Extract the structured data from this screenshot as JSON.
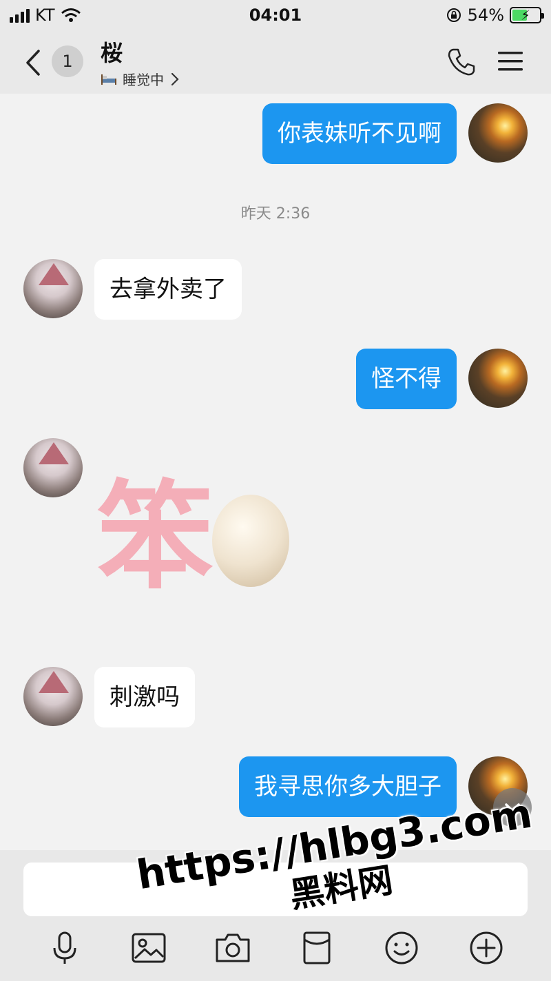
{
  "status_bar": {
    "carrier": "KT",
    "time": "04:01",
    "battery_percent": "54%",
    "battery_level": 0.54
  },
  "header": {
    "unread_count": "1",
    "contact_name": "桜",
    "status_text": "睡觉中"
  },
  "messages": [
    {
      "from": "me",
      "text": "你表妹听不见啊"
    },
    {
      "from": "timestamp",
      "text": "昨天 2:36"
    },
    {
      "from": "her",
      "text": "去拿外卖了"
    },
    {
      "from": "me",
      "text": "怪不得"
    },
    {
      "from": "her",
      "sticker": "笨蛋",
      "sticker_text": "笨"
    },
    {
      "from": "her",
      "text": "刺激吗"
    },
    {
      "from": "me",
      "text": "我寻思你多大胆子"
    }
  ],
  "input": {
    "placeholder": ""
  },
  "watermark": {
    "url": "https://hlbg3.com",
    "text": "黑料网"
  },
  "icons": [
    "signal-icon",
    "wifi-icon",
    "lock-rotation-icon",
    "battery-icon",
    "back-icon",
    "bed-icon",
    "chevron-right-icon",
    "phone-icon",
    "menu-icon",
    "chevron-down-icon",
    "microphone-icon",
    "image-icon",
    "camera-icon",
    "red-packet-icon",
    "emoji-icon",
    "plus-icon"
  ],
  "colors": {
    "outgoing_bubble": "#1c96f0",
    "incoming_bubble": "#ffffff",
    "chat_background": "#f2f2f2",
    "bar_background": "#e9e9e9"
  }
}
